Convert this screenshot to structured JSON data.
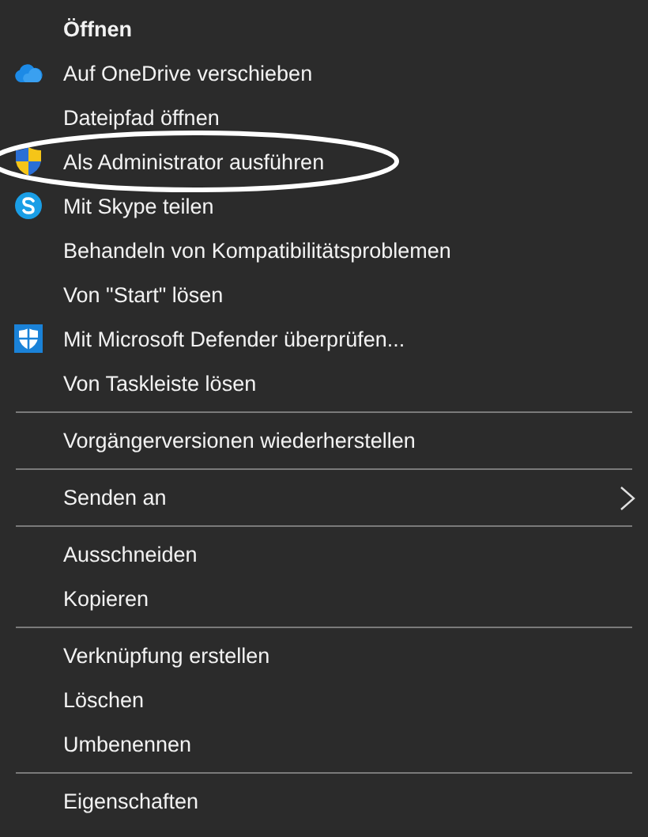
{
  "menu": {
    "items": [
      {
        "kind": "item",
        "label": "Öffnen",
        "default": true
      },
      {
        "kind": "item",
        "label": "Auf OneDrive verschieben",
        "default": false
      },
      {
        "kind": "item",
        "label": "Dateipfad öffnen",
        "default": false
      },
      {
        "kind": "item",
        "label": "Als Administrator ausführen",
        "default": false,
        "circled": true
      },
      {
        "kind": "item",
        "label": "Mit Skype teilen",
        "default": false
      },
      {
        "kind": "item",
        "label": "Behandeln von Kompatibilitätsproblemen",
        "default": false
      },
      {
        "kind": "item",
        "label": "Von \"Start\" lösen",
        "default": false
      },
      {
        "kind": "item",
        "label": "Mit Microsoft Defender überprüfen...",
        "default": false
      },
      {
        "kind": "item",
        "label": "Von Taskleiste lösen",
        "default": false
      },
      {
        "kind": "separator"
      },
      {
        "kind": "item",
        "label": "Vorgängerversionen wiederherstellen",
        "default": false
      },
      {
        "kind": "separator"
      },
      {
        "kind": "item",
        "label": "Senden an",
        "default": false,
        "submenu": true
      },
      {
        "kind": "separator"
      },
      {
        "kind": "item",
        "label": "Ausschneiden",
        "default": false
      },
      {
        "kind": "item",
        "label": "Kopieren",
        "default": false
      },
      {
        "kind": "separator"
      },
      {
        "kind": "item",
        "label": "Verknüpfung erstellen",
        "default": false
      },
      {
        "kind": "item",
        "label": "Löschen",
        "default": false
      },
      {
        "kind": "item",
        "label": "Umbenennen",
        "default": false
      },
      {
        "kind": "separator"
      },
      {
        "kind": "item",
        "label": "Eigenschaften",
        "default": false
      }
    ]
  }
}
